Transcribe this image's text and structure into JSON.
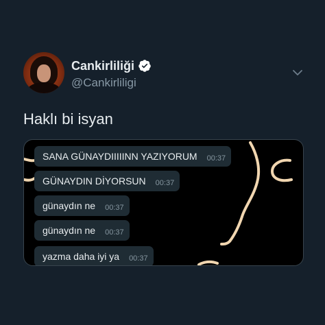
{
  "tweet": {
    "display_name": "Cankirliliği",
    "handle": "@Cankirliligi",
    "text": "Haklı bi isyan",
    "verified": true,
    "menu_icon": "chevron-down-icon"
  },
  "media": {
    "messages": [
      {
        "text": "SANA GÜNAYDIIIIINN YAZIYORUM",
        "time": "00:37"
      },
      {
        "text": "GÜNAYDIN DİYORSUN",
        "time": "00:37"
      },
      {
        "text": "günaydın ne",
        "time": "00:37"
      },
      {
        "text": "günaydın ne",
        "time": "00:37"
      },
      {
        "text": "yazma daha iyi ya",
        "time": "00:37"
      }
    ]
  },
  "colors": {
    "background": "#15202b",
    "verified_badge": "#ffffff",
    "bubble": "#1f2c34",
    "doodle": "#f1d6b0"
  }
}
